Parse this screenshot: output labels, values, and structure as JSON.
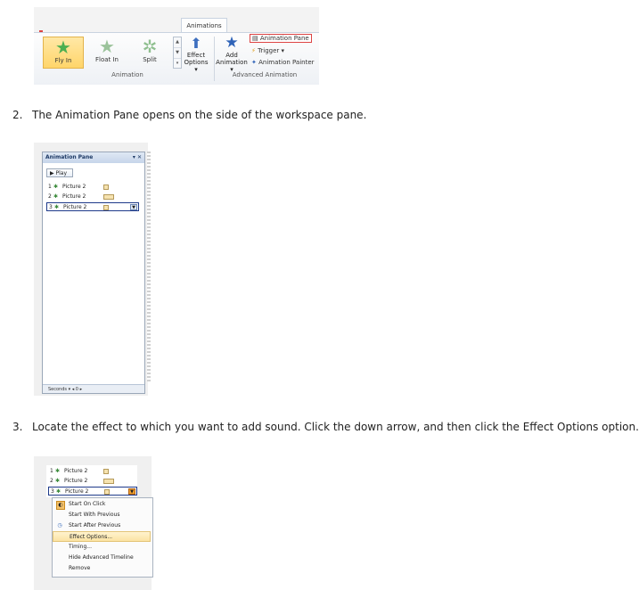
{
  "ribbon": {
    "tab_label": "Animations",
    "gallery": [
      {
        "label": "Fly In",
        "selected": true
      },
      {
        "label": "Float In",
        "selected": false
      },
      {
        "label": "Split",
        "selected": false
      }
    ],
    "effect_options": [
      "Effect",
      "Options ▾"
    ],
    "animation_group_label": "Animation",
    "add_animation": [
      "Add",
      "Animation ▾"
    ],
    "animation_pane": "Animation Pane",
    "trigger": "Trigger ▾",
    "animation_painter": "Animation Painter",
    "advanced_group_label": "Advanced Animation"
  },
  "steps": {
    "step2_number": "2.",
    "step2_text": "The Animation Pane opens on the side of the workspace pane.",
    "step3_number": "3.",
    "step3_text": "Locate the effect to which you want to add sound. Click the down arrow, and then click the Effect Options option."
  },
  "pane": {
    "title": "Animation Pane",
    "controls": "▾ ✕",
    "play_label": "▶ Play",
    "items": [
      {
        "num": "1",
        "label": "Picture 2"
      },
      {
        "num": "2",
        "label": "Picture 2"
      },
      {
        "num": "3",
        "label": "Picture 2"
      }
    ],
    "footer": "Seconds ▾ ◂ 0 ▸"
  },
  "menu": {
    "items": [
      {
        "num": "1",
        "label": "Picture 2"
      },
      {
        "num": "2",
        "label": "Picture 2"
      },
      {
        "num": "3",
        "label": "Picture 2"
      }
    ],
    "options": [
      "Start On Click",
      "Start With Previous",
      "Start After Previous",
      "Effect Options...",
      "Timing...",
      "Hide Advanced Timeline",
      "Remove"
    ]
  },
  "colors": {
    "highlight": "#fbe3a3",
    "accent_red": "#dd4444",
    "pane_header": "#c6d5ea"
  }
}
